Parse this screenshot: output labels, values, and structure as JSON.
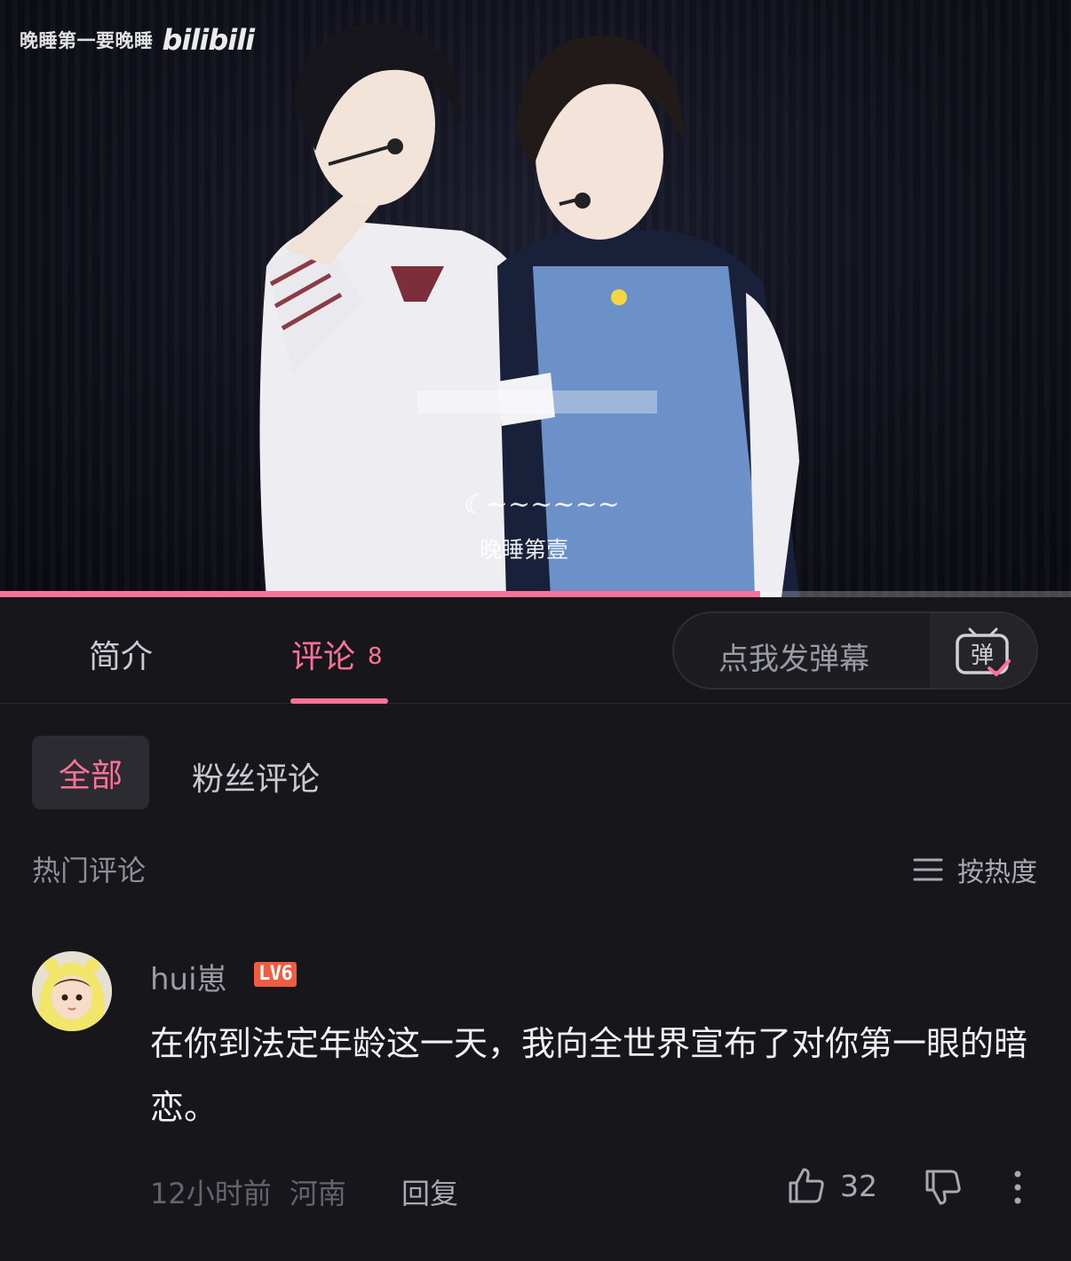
{
  "video": {
    "watermark_text": "晚睡第一要晚睡",
    "watermark_logo": "bilibili",
    "subtitle_zh": "晚睡第壹",
    "progress_fraction": 0.71,
    "accent": "#fb7299"
  },
  "tabs": {
    "intro_label": "简介",
    "comments_label": "评论",
    "comments_count": "8",
    "danmaku_placeholder": "点我发弹幕",
    "danmaku_icon_char": "弹"
  },
  "filters": {
    "all_label": "全部",
    "fans_label": "粉丝评论"
  },
  "hot": {
    "title": "热门评论",
    "sort_label": "按热度",
    "sort_icon": "menu-lines-icon"
  },
  "comment": {
    "username": "hui崽",
    "level": "LV6",
    "text": "在你到法定年龄这一天，我向全世界宣布了对你第一眼的暗恋。",
    "time": "12小时前",
    "location": "河南",
    "reply_label": "回复",
    "likes": "32",
    "icons": [
      "thumbs-up-icon",
      "thumbs-down-icon",
      "more-vertical-icon"
    ]
  }
}
